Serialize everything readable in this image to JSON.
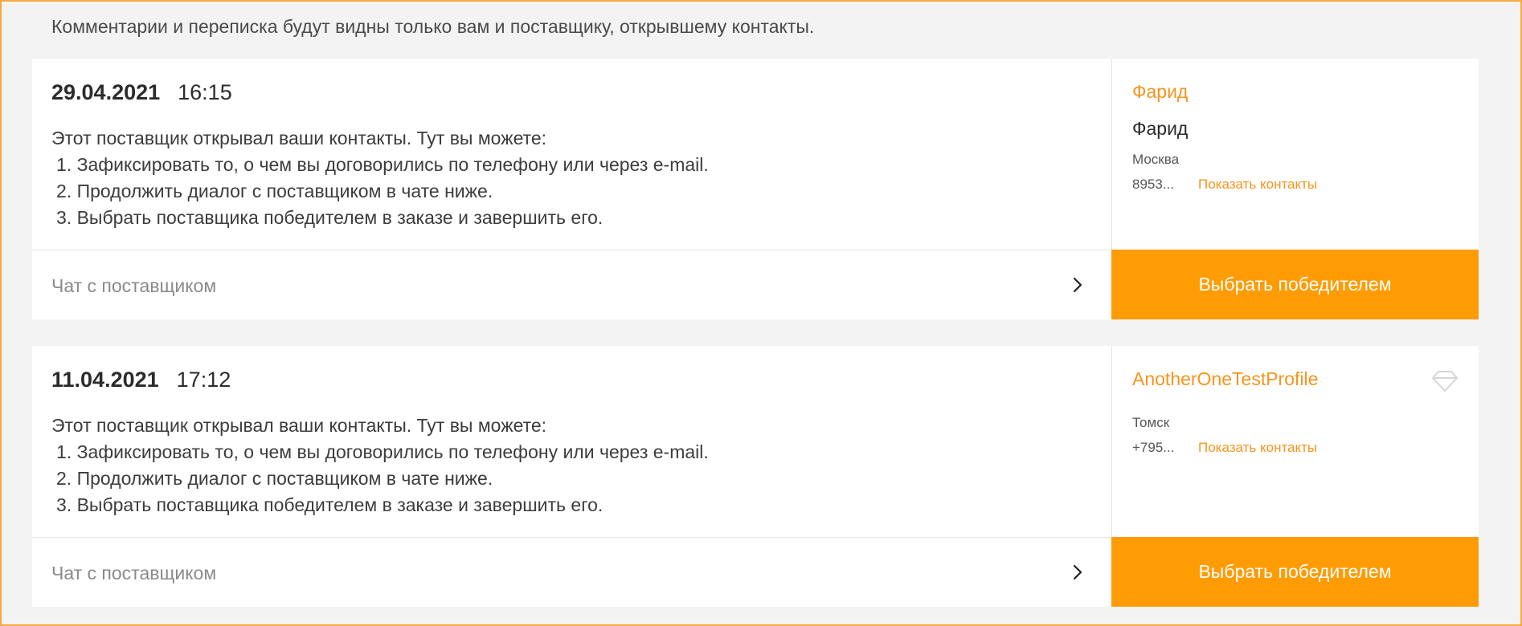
{
  "notice": "Комментарии и переписка будут видны только вам и поставщику, открывшему контакты.",
  "colors": {
    "accent": "#ff9c04",
    "link": "#f7941d",
    "frame": "#f7a93a",
    "background": "#f3f3f3"
  },
  "offers": [
    {
      "date": "29.04.2021",
      "time": "16:15",
      "message": {
        "intro": "Этот поставщик открывал ваши контакты. Тут вы можете:",
        "items": [
          "1. Зафиксировать то, о чем вы договорились по телефону или через e-mail.",
          "2. Продолжить диалог с поставщиком в чате ниже.",
          "3. Выбрать поставщика победителем в заказе и завершить его."
        ]
      },
      "chat_label": "Чат с поставщиком",
      "supplier": {
        "profile_link": "Фарид",
        "name": "Фарид",
        "city": "Москва",
        "phone": "8953...",
        "show_contacts": "Показать контакты"
      },
      "winner_button": "Выбрать победителем"
    },
    {
      "date": "11.04.2021",
      "time": "17:12",
      "message": {
        "intro": "Этот поставщик открывал ваши контакты. Тут вы можете:",
        "items": [
          "1. Зафиксировать то, о чем вы договорились по телефону или через e-mail.",
          "2. Продолжить диалог с поставщиком в чате ниже.",
          "3. Выбрать поставщика победителем в заказе и завершить его."
        ]
      },
      "chat_label": "Чат с поставщиком",
      "supplier": {
        "profile_link": "AnotherOneTestProfile",
        "city": "Томск",
        "phone": "+795...",
        "show_contacts": "Показать контакты",
        "badge_icon": "diamond-icon"
      },
      "winner_button": "Выбрать победителем"
    }
  ]
}
